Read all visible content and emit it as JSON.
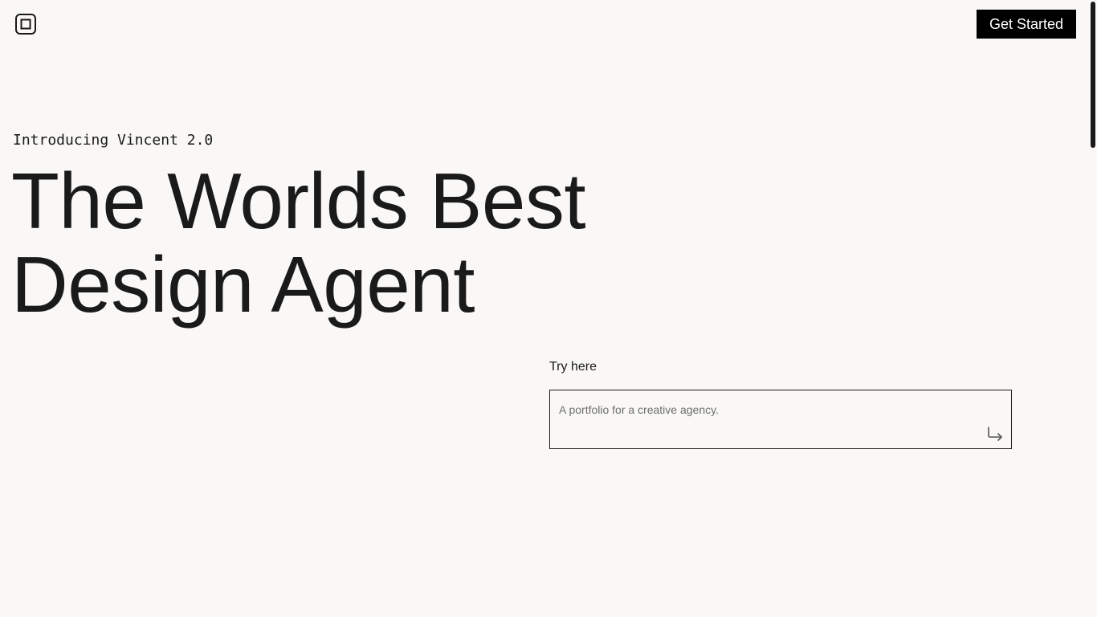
{
  "header": {
    "logo_icon": "square-logo-icon",
    "cta_label": "Get Started"
  },
  "hero": {
    "eyebrow": "Introducing Vincent 2.0",
    "headline_line1": "The Worlds Best",
    "headline_line2": "Design Agent"
  },
  "prompt": {
    "label": "Try here",
    "placeholder": "A portfolio for a creative agency.",
    "value": "",
    "submit_icon": "enter-return-icon"
  },
  "colors": {
    "background": "#f9f8f6",
    "text": "#1a1a1a",
    "button_bg": "#000000",
    "button_text": "#ffffff",
    "placeholder": "#6f6f6f"
  }
}
